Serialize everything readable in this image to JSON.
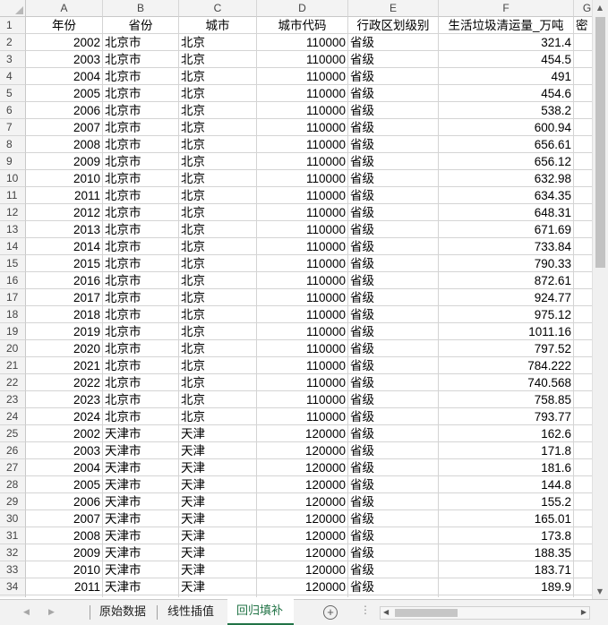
{
  "columns": [
    "A",
    "B",
    "C",
    "D",
    "E",
    "F",
    "G"
  ],
  "headers": [
    "年份",
    "省份",
    "城市",
    "城市代码",
    "行政区划级别",
    "生活垃圾清运量_万吨",
    "密"
  ],
  "rows": [
    [
      "2002",
      "北京市",
      "北京",
      "110000",
      "省级",
      "321.4"
    ],
    [
      "2003",
      "北京市",
      "北京",
      "110000",
      "省级",
      "454.5"
    ],
    [
      "2004",
      "北京市",
      "北京",
      "110000",
      "省级",
      "491"
    ],
    [
      "2005",
      "北京市",
      "北京",
      "110000",
      "省级",
      "454.6"
    ],
    [
      "2006",
      "北京市",
      "北京",
      "110000",
      "省级",
      "538.2"
    ],
    [
      "2007",
      "北京市",
      "北京",
      "110000",
      "省级",
      "600.94"
    ],
    [
      "2008",
      "北京市",
      "北京",
      "110000",
      "省级",
      "656.61"
    ],
    [
      "2009",
      "北京市",
      "北京",
      "110000",
      "省级",
      "656.12"
    ],
    [
      "2010",
      "北京市",
      "北京",
      "110000",
      "省级",
      "632.98"
    ],
    [
      "2011",
      "北京市",
      "北京",
      "110000",
      "省级",
      "634.35"
    ],
    [
      "2012",
      "北京市",
      "北京",
      "110000",
      "省级",
      "648.31"
    ],
    [
      "2013",
      "北京市",
      "北京",
      "110000",
      "省级",
      "671.69"
    ],
    [
      "2014",
      "北京市",
      "北京",
      "110000",
      "省级",
      "733.84"
    ],
    [
      "2015",
      "北京市",
      "北京",
      "110000",
      "省级",
      "790.33"
    ],
    [
      "2016",
      "北京市",
      "北京",
      "110000",
      "省级",
      "872.61"
    ],
    [
      "2017",
      "北京市",
      "北京",
      "110000",
      "省级",
      "924.77"
    ],
    [
      "2018",
      "北京市",
      "北京",
      "110000",
      "省级",
      "975.12"
    ],
    [
      "2019",
      "北京市",
      "北京",
      "110000",
      "省级",
      "1011.16"
    ],
    [
      "2020",
      "北京市",
      "北京",
      "110000",
      "省级",
      "797.52"
    ],
    [
      "2021",
      "北京市",
      "北京",
      "110000",
      "省级",
      "784.222"
    ],
    [
      "2022",
      "北京市",
      "北京",
      "110000",
      "省级",
      "740.568"
    ],
    [
      "2023",
      "北京市",
      "北京",
      "110000",
      "省级",
      "758.85"
    ],
    [
      "2024",
      "北京市",
      "北京",
      "110000",
      "省级",
      "793.77"
    ],
    [
      "2002",
      "天津市",
      "天津",
      "120000",
      "省级",
      "162.6"
    ],
    [
      "2003",
      "天津市",
      "天津",
      "120000",
      "省级",
      "171.8"
    ],
    [
      "2004",
      "天津市",
      "天津",
      "120000",
      "省级",
      "181.6"
    ],
    [
      "2005",
      "天津市",
      "天津",
      "120000",
      "省级",
      "144.8"
    ],
    [
      "2006",
      "天津市",
      "天津",
      "120000",
      "省级",
      "155.2"
    ],
    [
      "2007",
      "天津市",
      "天津",
      "120000",
      "省级",
      "165.01"
    ],
    [
      "2008",
      "天津市",
      "天津",
      "120000",
      "省级",
      "173.8"
    ],
    [
      "2009",
      "天津市",
      "天津",
      "120000",
      "省级",
      "188.35"
    ],
    [
      "2010",
      "天津市",
      "天津",
      "120000",
      "省级",
      "183.71"
    ],
    [
      "2011",
      "天津市",
      "天津",
      "120000",
      "省级",
      "189.9"
    ]
  ],
  "sheets": {
    "tab1": "原始数据",
    "tab2": "线性插值",
    "tab3": "回归填补",
    "active": "回归填补"
  },
  "colors": {
    "active_tab": "#217346",
    "header_bg": "#f3f3f3",
    "grid_line": "#d4d4d4"
  }
}
